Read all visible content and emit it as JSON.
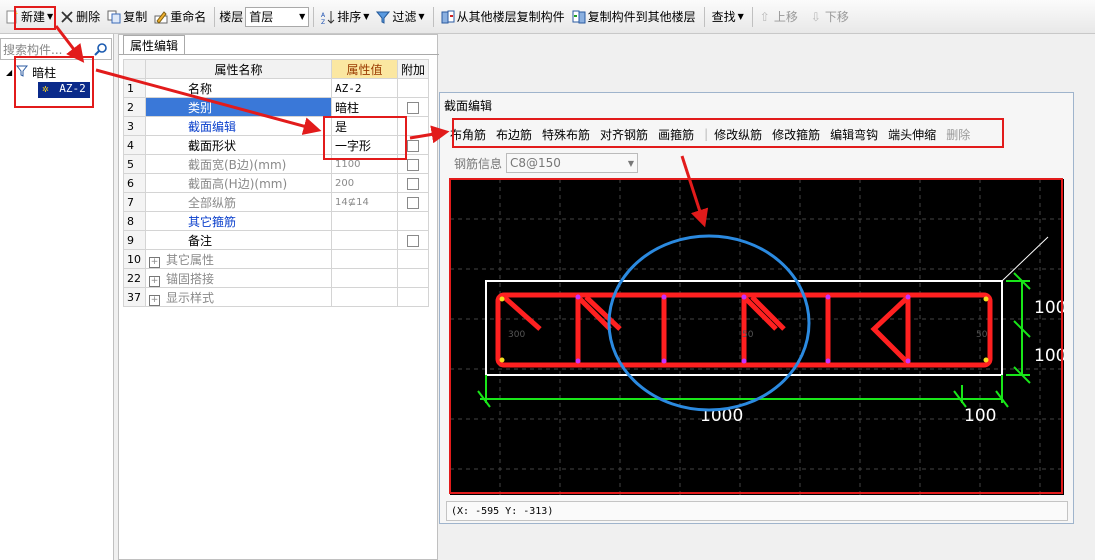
{
  "toolbar": {
    "new_label": "新建",
    "delete_label": "删除",
    "copy_label": "复制",
    "rename_label": "重命名",
    "floor_label": "楼层",
    "floor_value": "首层",
    "sort_label": "排序",
    "filter_label": "过滤",
    "copy_from_floor_label": "从其他楼层复制构件",
    "copy_to_floor_label": "复制构件到其他楼层",
    "find_label": "查找",
    "move_up_label": "上移",
    "move_down_label": "下移"
  },
  "left_panel": {
    "search_placeholder": "搜索构件...",
    "tree": {
      "root": "暗柱",
      "child": "AZ-2"
    }
  },
  "props_panel": {
    "tab": "属性编辑",
    "headers": {
      "name": "属性名称",
      "value": "属性值",
      "extra": "附加"
    },
    "rows": [
      {
        "num": "1",
        "name": "名称",
        "value": "AZ-2"
      },
      {
        "num": "2",
        "name": "类别",
        "value": "暗柱"
      },
      {
        "num": "3",
        "name": "截面编辑",
        "value": "是"
      },
      {
        "num": "4",
        "name": "截面形状",
        "value": "一字形"
      },
      {
        "num": "5",
        "name": "截面宽(B边)(mm)",
        "value": "1100"
      },
      {
        "num": "6",
        "name": "截面高(H边)(mm)",
        "value": "200"
      },
      {
        "num": "7",
        "name": "全部纵筋",
        "value": "14⊈14"
      },
      {
        "num": "8",
        "name": "其它箍筋",
        "value": ""
      },
      {
        "num": "9",
        "name": "备注",
        "value": ""
      },
      {
        "num": "10",
        "name": "其它属性",
        "value": ""
      },
      {
        "num": "22",
        "name": "锚固搭接",
        "value": ""
      },
      {
        "num": "37",
        "name": "显示样式",
        "value": ""
      }
    ]
  },
  "section_dialog": {
    "title": "截面编辑",
    "tools": [
      "布角筋",
      "布边筋",
      "特殊布筋",
      "对齐钢筋",
      "画箍筋",
      "修改纵筋",
      "修改箍筋",
      "编辑弯钩",
      "端头伸缩",
      "删除"
    ],
    "rebar_info_label": "钢筋信息",
    "rebar_info_value": "C8@150",
    "status": "(X: -595 Y: -313)"
  },
  "drawing": {
    "dim_width": "1000",
    "dim_end": "100",
    "dim_top": "100",
    "dim_bottom": "100",
    "small_labels": [
      "300",
      "50",
      "50"
    ]
  },
  "colors": {
    "annotation_red": "#e21b1b",
    "circle_blue": "#2b8ae0",
    "dim_green": "#19e619",
    "rebar_red": "#ff2020",
    "selection_blue": "#0a2a8a"
  }
}
